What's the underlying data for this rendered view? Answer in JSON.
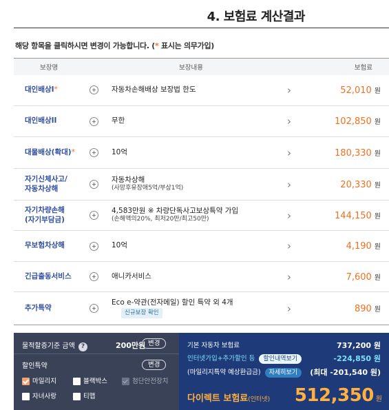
{
  "title": "4. 보험료 계산결과",
  "notice": {
    "text": "해당 항목을 클릭하시면 변경이 가능합니다. (",
    "star": "*",
    "after": " 표시는 의무가입)"
  },
  "table": {
    "headers": {
      "name": "보장명",
      "desc": "보장내용",
      "premium": "보험료"
    },
    "currency": "원",
    "rows": [
      {
        "name": "대인배상I",
        "required": true,
        "desc": "자동차손해배상 보장법 한도",
        "sub": "",
        "premium": "52,010"
      },
      {
        "name": "대인배상II",
        "required": false,
        "desc": "무한",
        "sub": "",
        "premium": "102,850"
      },
      {
        "name": "대물배상(확대)",
        "required": true,
        "desc": "10억",
        "sub": "",
        "premium": "180,330"
      },
      {
        "name": "자기신체사고/\n자동차상해",
        "required": false,
        "desc": "자동차상해",
        "sub": "(사망후유장애5억/부상1억)",
        "premium": "20,330"
      },
      {
        "name": "자기차량손해\n(자기부담금)",
        "required": false,
        "desc": "4,583만원 ※ 차량단독사고보상특약 가입",
        "sub": "(손해액의20%, 최저20만/최고50만)",
        "premium": "144,150"
      },
      {
        "name": "무보험차상해",
        "required": false,
        "desc": "10억",
        "sub": "",
        "premium": "4,190"
      },
      {
        "name": "긴급출동서비스",
        "required": false,
        "desc": "애니카서비스",
        "sub": "",
        "premium": "7,600"
      },
      {
        "name": "추가특약",
        "required": false,
        "desc": "Eco e-약관(전자메일) 할인 특약 외 4개",
        "sub": "",
        "badge": "신규보장 확인",
        "premium": "890"
      }
    ]
  },
  "summary": {
    "mileage_label": "물적할증기준 금액",
    "mileage_value": "200만원",
    "change_label": "변경",
    "discount_label": "할인특약",
    "checkboxes": [
      {
        "label": "마일리지",
        "checked": true,
        "disabled": false
      },
      {
        "label": "블랙박스",
        "checked": false,
        "disabled": false
      },
      {
        "label": "첨단안전장치",
        "checked": true,
        "disabled": true
      },
      {
        "label": "자녀사랑",
        "checked": false,
        "disabled": false
      },
      {
        "label": "티맵",
        "checked": false,
        "disabled": false
      }
    ],
    "base_label": "기본 자동차 보험료",
    "base_value": "737,200 원",
    "online_label": "인터넷가입+추가할인 등",
    "online_pill": "할인내역보기",
    "online_value": "-224,850 원",
    "refund_label": "(마일리지특약 예상환급금)",
    "refund_pill": "자세히보기",
    "refund_value": "(최대 -201,540 원)",
    "direct_label": "다이렉트 보험료",
    "direct_sub": "(인터넷)",
    "total": "512,350",
    "total_unit": "원"
  }
}
